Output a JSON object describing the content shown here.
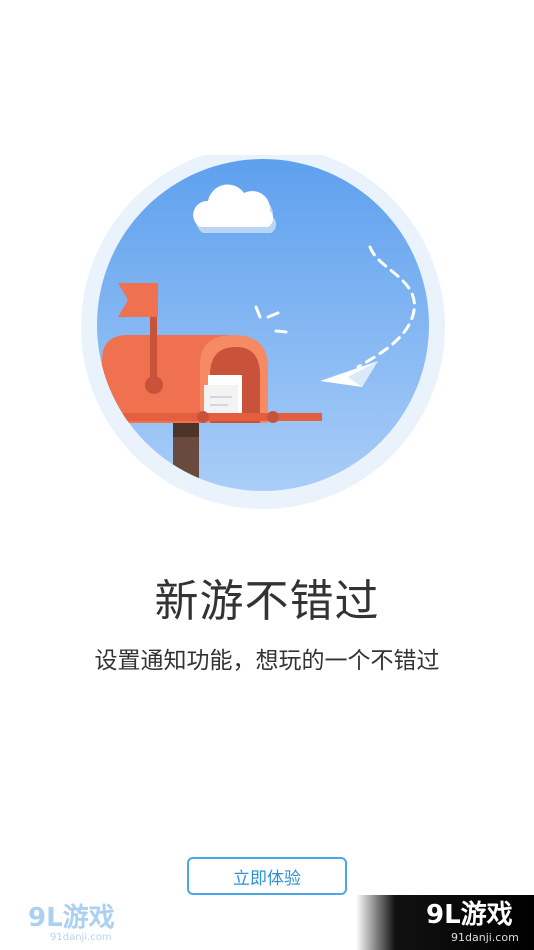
{
  "onboarding": {
    "title": "新游不错过",
    "subtitle": "设置通知功能，想玩的一个不错过",
    "cta_label": "立即体验"
  },
  "illustration": {
    "icons": [
      "cloud-icon",
      "mailbox-icon",
      "flag-icon",
      "letter-icon",
      "paper-plane-icon"
    ],
    "colors": {
      "sky": "#6aa9f0",
      "mailbox": "#f0714f",
      "ring": "#e8f1fb"
    }
  },
  "watermark": {
    "brand": "9L游戏",
    "site": "91danji.com"
  },
  "colors": {
    "accent": "#4aa8e8",
    "text": "#333333"
  }
}
